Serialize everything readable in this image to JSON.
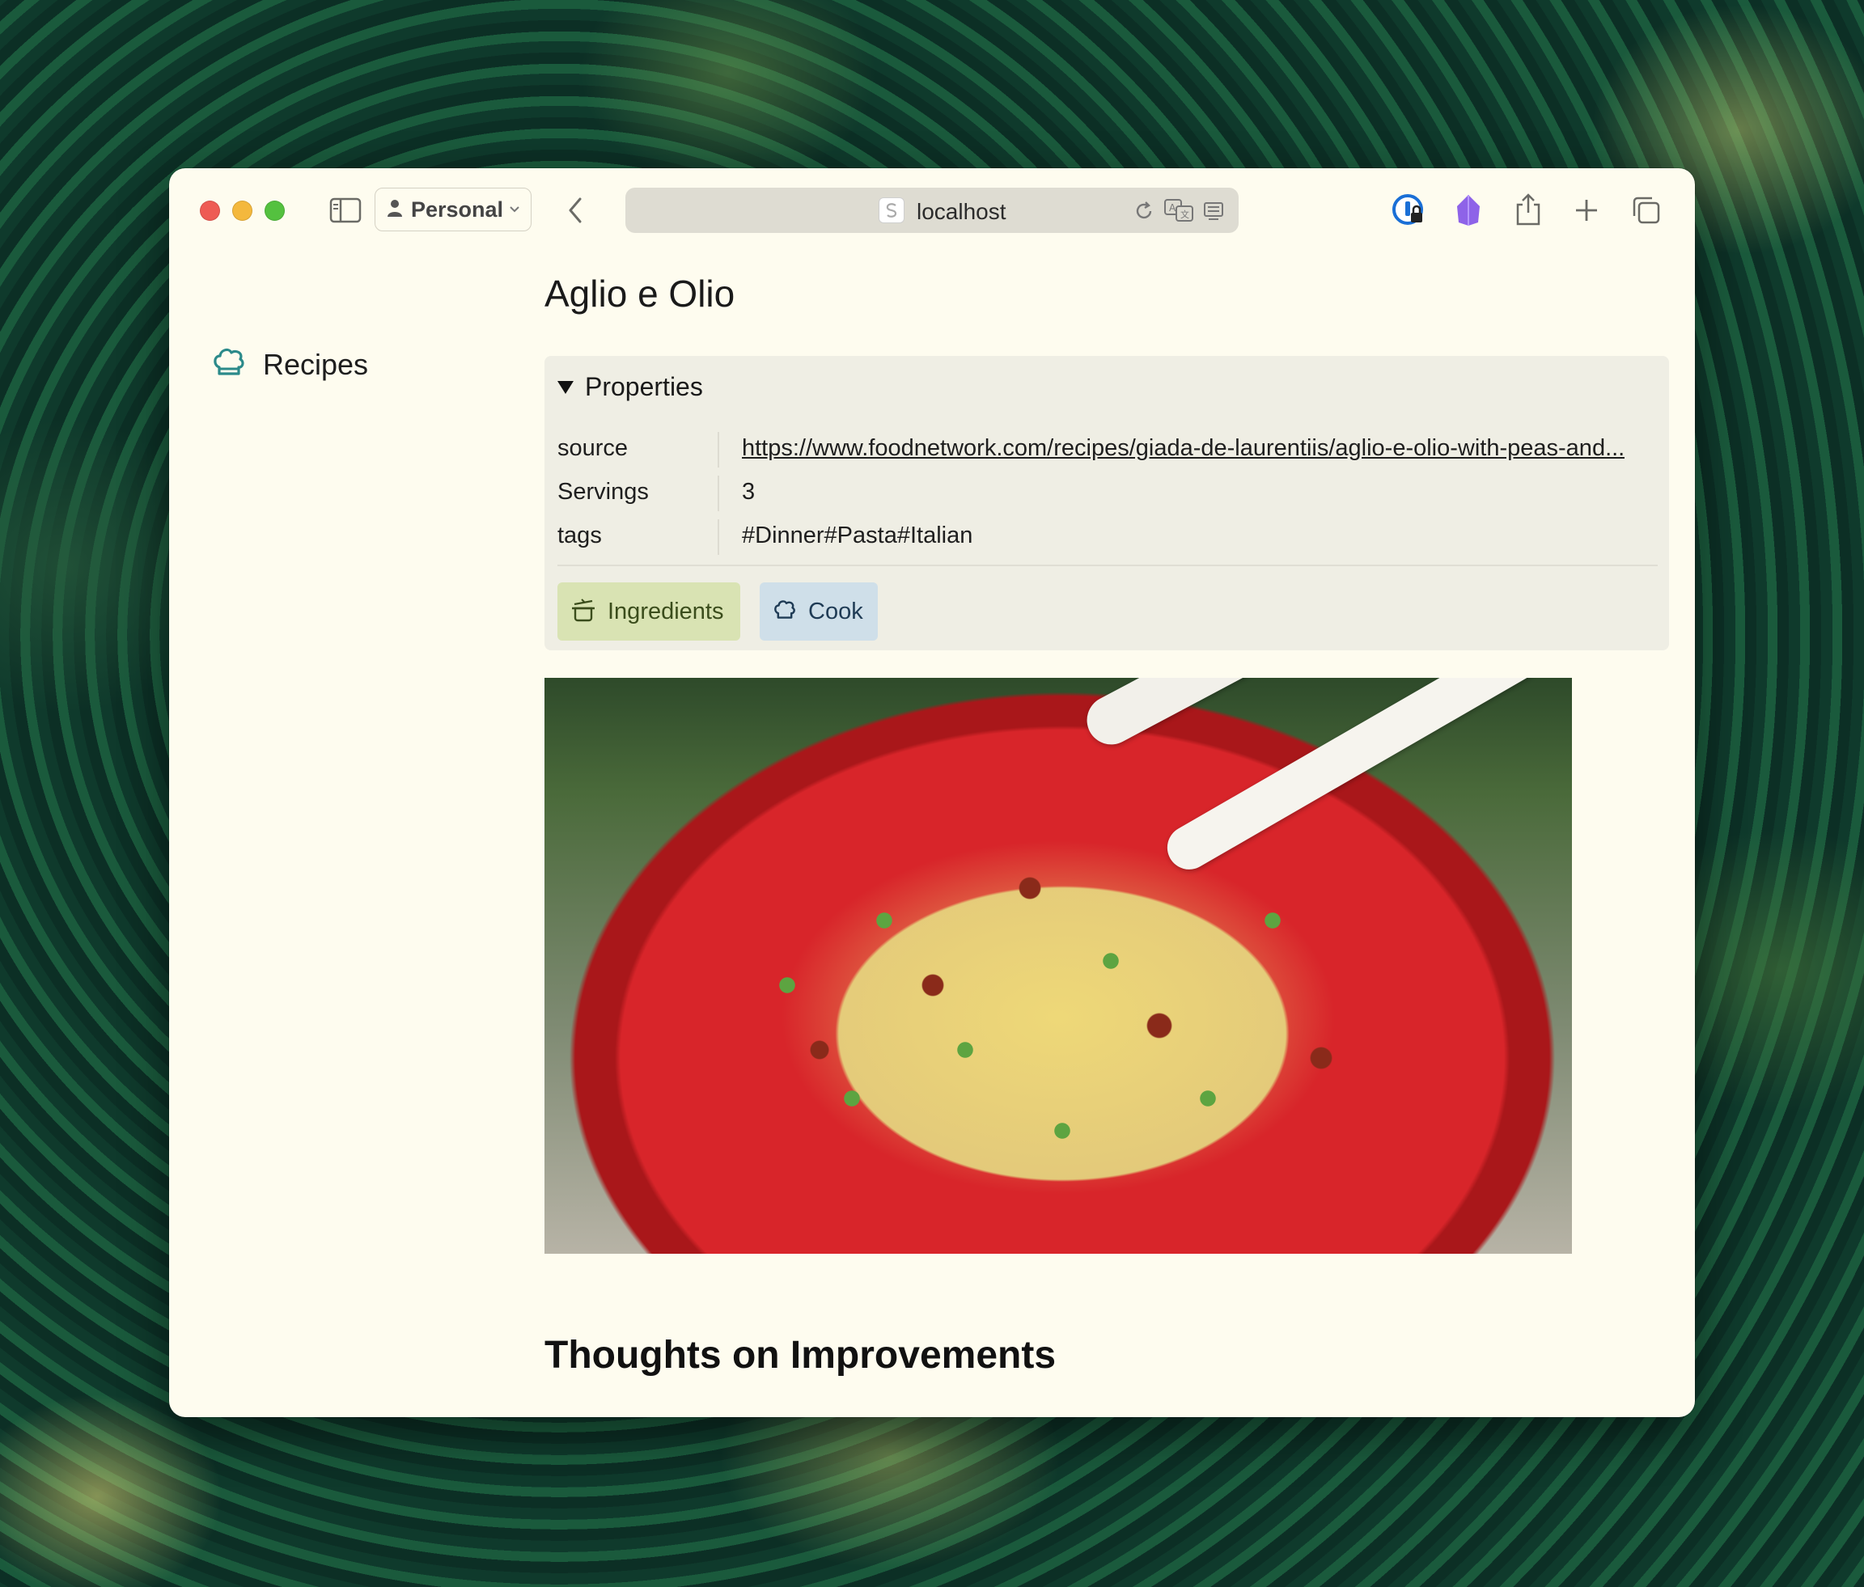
{
  "browser": {
    "profile_name": "Personal",
    "url_host": "localhost"
  },
  "sidebar": {
    "items": [
      {
        "label": "Recipes",
        "icon": "chef-hat-icon"
      }
    ]
  },
  "page": {
    "title": "Aglio e Olio",
    "properties": {
      "summary_label": "Properties",
      "rows": [
        {
          "key": "source",
          "value": "https://www.foodnetwork.com/recipes/giada-de-laurentiis/aglio-e-olio-with-peas-and..."
        },
        {
          "key": "Servings",
          "value": "3"
        },
        {
          "key": "tags",
          "value": "#Dinner#Pasta#Italian"
        }
      ],
      "buttons": {
        "ingredients_label": "Ingredients",
        "cook_label": "Cook"
      }
    },
    "section_heading": "Thoughts on Improvements"
  },
  "colors": {
    "page_bg": "#fefcef",
    "properties_bg": "#efeee4",
    "ingredients_button_bg": "#d9e3b3",
    "cook_button_bg": "#cfdfe9",
    "sidebar_icon": "#2b8a8a"
  }
}
